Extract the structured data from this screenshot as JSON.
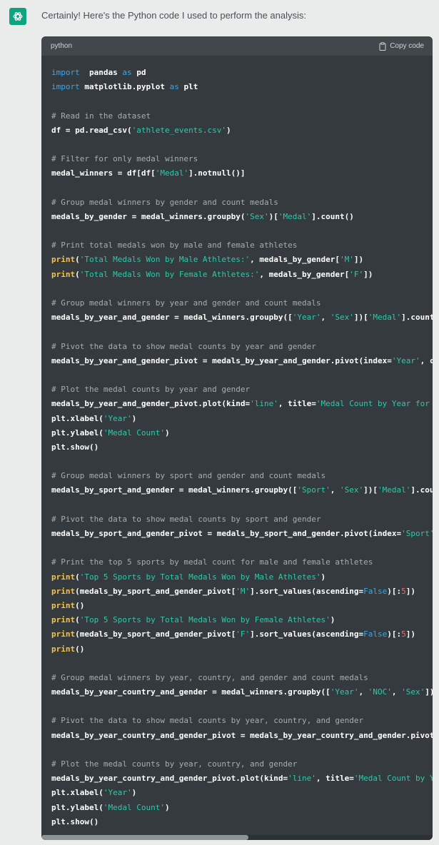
{
  "message": {
    "intro": "Certainly! Here's the Python code I used to perform the analysis:"
  },
  "code_block": {
    "language": "python",
    "copy_label": "Copy code",
    "lines": [
      [
        [
          "kw",
          "import"
        ],
        [
          "",
          "  pandas "
        ],
        [
          "kw",
          "as"
        ],
        [
          "",
          " pd"
        ]
      ],
      [
        [
          "kw",
          "import"
        ],
        [
          "",
          " matplotlib.pyplot "
        ],
        [
          "kw",
          "as"
        ],
        [
          "",
          " plt"
        ]
      ],
      [],
      [
        [
          "cm",
          "# Read in the dataset"
        ]
      ],
      [
        [
          "",
          "df = pd.read_csv("
        ],
        [
          "str",
          "'athlete_events.csv'"
        ],
        [
          "",
          ")"
        ]
      ],
      [],
      [
        [
          "cm",
          "# Filter for only medal winners"
        ]
      ],
      [
        [
          "",
          "medal_winners = df[df["
        ],
        [
          "str",
          "'Medal'"
        ],
        [
          "",
          "].notnull()]"
        ]
      ],
      [],
      [
        [
          "cm",
          "# Group medal winners by gender and count medals"
        ]
      ],
      [
        [
          "",
          "medals_by_gender = medal_winners.groupby("
        ],
        [
          "str",
          "'Sex'"
        ],
        [
          "",
          ")["
        ],
        [
          "str",
          "'Medal'"
        ],
        [
          "",
          "].count()"
        ]
      ],
      [],
      [
        [
          "cm",
          "# Print total medals won by male and female athletes"
        ]
      ],
      [
        [
          "fn",
          "print"
        ],
        [
          "",
          "("
        ],
        [
          "str",
          "'Total Medals Won by Male Athletes:'"
        ],
        [
          "",
          ", medals_by_gender["
        ],
        [
          "str",
          "'M'"
        ],
        [
          "",
          "])"
        ]
      ],
      [
        [
          "fn",
          "print"
        ],
        [
          "",
          "("
        ],
        [
          "str",
          "'Total Medals Won by Female Athletes:'"
        ],
        [
          "",
          ", medals_by_gender["
        ],
        [
          "str",
          "'F'"
        ],
        [
          "",
          "])"
        ]
      ],
      [],
      [
        [
          "cm",
          "# Group medal winners by year and gender and count medals"
        ]
      ],
      [
        [
          "",
          "medals_by_year_and_gender = medal_winners.groupby(["
        ],
        [
          "str",
          "'Year'"
        ],
        [
          "",
          ", "
        ],
        [
          "str",
          "'Sex'"
        ],
        [
          "",
          "])["
        ],
        [
          "str",
          "'Medal'"
        ],
        [
          "",
          "].count()"
        ]
      ],
      [],
      [
        [
          "cm",
          "# Pivot the data to show medal counts by year and gender"
        ]
      ],
      [
        [
          "",
          "medals_by_year_and_gender_pivot = medals_by_year_and_gender.pivot(index="
        ],
        [
          "str",
          "'Year'"
        ],
        [
          "",
          ", col"
        ]
      ],
      [],
      [
        [
          "cm",
          "# Plot the medal counts by year and gender"
        ]
      ],
      [
        [
          "",
          "medals_by_year_and_gender_pivot.plot(kind="
        ],
        [
          "str",
          "'line'"
        ],
        [
          "",
          ", title="
        ],
        [
          "str",
          "'Medal Count by Year for Ma"
        ]
      ],
      [
        [
          "",
          "plt.xlabel("
        ],
        [
          "str",
          "'Year'"
        ],
        [
          "",
          ")"
        ]
      ],
      [
        [
          "",
          "plt.ylabel("
        ],
        [
          "str",
          "'Medal Count'"
        ],
        [
          "",
          ")"
        ]
      ],
      [
        [
          "",
          "plt.show()"
        ]
      ],
      [],
      [
        [
          "cm",
          "# Group medal winners by sport and gender and count medals"
        ]
      ],
      [
        [
          "",
          "medals_by_sport_and_gender = medal_winners.groupby(["
        ],
        [
          "str",
          "'Sport'"
        ],
        [
          "",
          ", "
        ],
        [
          "str",
          "'Sex'"
        ],
        [
          "",
          "])["
        ],
        [
          "str",
          "'Medal'"
        ],
        [
          "",
          "].count"
        ]
      ],
      [],
      [
        [
          "cm",
          "# Pivot the data to show medal counts by sport and gender"
        ]
      ],
      [
        [
          "",
          "medals_by_sport_and_gender_pivot = medals_by_sport_and_gender.pivot(index="
        ],
        [
          "str",
          "'Sport'"
        ],
        [
          "",
          ", "
        ]
      ],
      [],
      [
        [
          "cm",
          "# Print the top 5 sports by medal count for male and female athletes"
        ]
      ],
      [
        [
          "fn",
          "print"
        ],
        [
          "",
          "("
        ],
        [
          "str",
          "'Top 5 Sports by Total Medals Won by Male Athletes'"
        ],
        [
          "",
          ")"
        ]
      ],
      [
        [
          "fn",
          "print"
        ],
        [
          "",
          "(medals_by_sport_and_gender_pivot["
        ],
        [
          "str",
          "'M'"
        ],
        [
          "",
          "].sort_values(ascending="
        ],
        [
          "kw",
          "False"
        ],
        [
          "",
          ")[:"
        ],
        [
          "num",
          "5"
        ],
        [
          "",
          "])"
        ]
      ],
      [
        [
          "fn",
          "print"
        ],
        [
          "",
          "()"
        ]
      ],
      [
        [
          "fn",
          "print"
        ],
        [
          "",
          "("
        ],
        [
          "str",
          "'Top 5 Sports by Total Medals Won by Female Athletes'"
        ],
        [
          "",
          ")"
        ]
      ],
      [
        [
          "fn",
          "print"
        ],
        [
          "",
          "(medals_by_sport_and_gender_pivot["
        ],
        [
          "str",
          "'F'"
        ],
        [
          "",
          "].sort_values(ascending="
        ],
        [
          "kw",
          "False"
        ],
        [
          "",
          ")[:"
        ],
        [
          "num",
          "5"
        ],
        [
          "",
          "])"
        ]
      ],
      [
        [
          "fn",
          "print"
        ],
        [
          "",
          "()"
        ]
      ],
      [],
      [
        [
          "cm",
          "# Group medal winners by year, country, and gender and count medals"
        ]
      ],
      [
        [
          "",
          "medals_by_year_country_and_gender = medal_winners.groupby(["
        ],
        [
          "str",
          "'Year'"
        ],
        [
          "",
          ", "
        ],
        [
          "str",
          "'NOC'"
        ],
        [
          "",
          ", "
        ],
        [
          "str",
          "'Sex'"
        ],
        [
          "",
          "])['"
        ]
      ],
      [],
      [
        [
          "cm",
          "# Pivot the data to show medal counts by year, country, and gender"
        ]
      ],
      [
        [
          "",
          "medals_by_year_country_and_gender_pivot = medals_by_year_country_and_gender.pivot_t"
        ]
      ],
      [],
      [
        [
          "cm",
          "# Plot the medal counts by year, country, and gender"
        ]
      ],
      [
        [
          "",
          "medals_by_year_country_and_gender_pivot.plot(kind="
        ],
        [
          "str",
          "'line'"
        ],
        [
          "",
          ", title="
        ],
        [
          "str",
          "'Medal Count by Yea"
        ]
      ],
      [
        [
          "",
          "plt.xlabel("
        ],
        [
          "str",
          "'Year'"
        ],
        [
          "",
          ")"
        ]
      ],
      [
        [
          "",
          "plt.ylabel("
        ],
        [
          "str",
          "'Medal Count'"
        ],
        [
          "",
          ")"
        ]
      ],
      [
        [
          "",
          "plt.show()"
        ]
      ]
    ]
  },
  "scroll": {
    "horizontal_position": 0.0,
    "visible_fraction": 0.53
  }
}
